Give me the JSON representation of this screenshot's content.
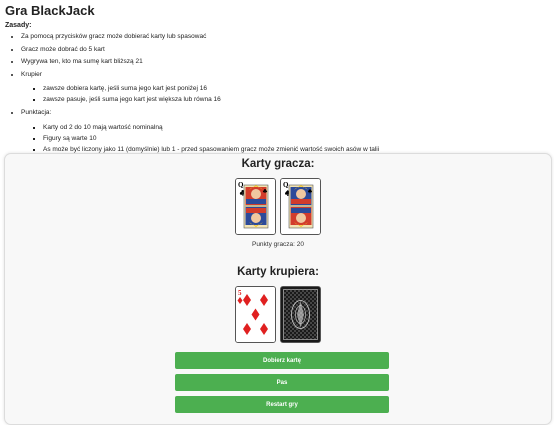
{
  "page": {
    "title": "Gra BlackJack"
  },
  "rules": {
    "heading": "Zasady:",
    "items": [
      "Za pomocą przycisków gracz może dobierać karty lub spasować",
      "Gracz może dobrać do 5 kart",
      "Wygrywa ten, kto ma sumę kart bliższą 21"
    ],
    "dealer_label": "Krupier",
    "dealer_items": [
      "zawsze dobiera kartę, jeśli suma jego kart jest poniżej 16",
      "zawsze pasuje, jeśli suma jego kart jest większa lub równa 16"
    ],
    "scoring_label": "Punktacja:",
    "scoring_items": [
      "Karty od 2 do 10 mają wartość nominalną",
      "Figury są warte 10",
      "As może być liczony jako 11 (domyślnie) lub 1 - przed spasowaniem gracz może zmienić wartość swoich asów w talii"
    ]
  },
  "game": {
    "player_title": "Karty gracza:",
    "player_cards": [
      {
        "rank": "Q",
        "suit": "clubs",
        "suit_icon": "club-icon",
        "color": "#000000"
      },
      {
        "rank": "Q",
        "suit": "spades",
        "suit_icon": "spade-icon",
        "color": "#000000"
      }
    ],
    "player_points": "Punkty gracza: 20",
    "dealer_title": "Karty krupiera:",
    "dealer_cards": [
      {
        "rank": "5",
        "suit": "diamonds",
        "suit_icon": "diamond-icon",
        "color": "#e02020"
      },
      {
        "face_down": true
      }
    ]
  },
  "buttons": {
    "draw": "Dobierz kartę",
    "pass": "Pas",
    "restart": "Restart gry"
  },
  "colors": {
    "button": "#4caf50",
    "button_text": "#ffffff",
    "red_suit": "#e02020",
    "card_back": "#1a1a1a"
  }
}
